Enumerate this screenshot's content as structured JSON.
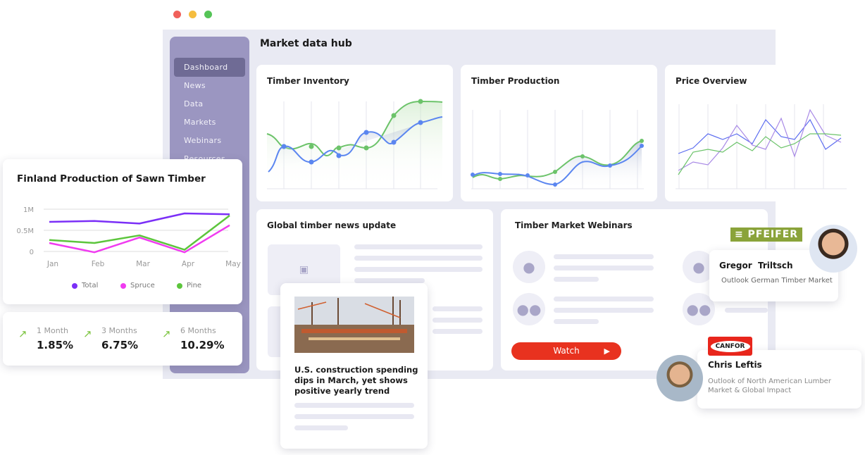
{
  "window": {
    "title": "Market data hub",
    "controls": [
      "close",
      "minimize",
      "maximize"
    ]
  },
  "sidebar": {
    "items": [
      {
        "label": "Dashboard",
        "active": true
      },
      {
        "label": "News"
      },
      {
        "label": "Data"
      },
      {
        "label": "Markets"
      },
      {
        "label": "Webinars"
      },
      {
        "label": "Resources"
      }
    ]
  },
  "cards": {
    "inventory": "Timber Inventory",
    "production": "Timber Production",
    "price": "Price Overview",
    "news": "Global timber news update",
    "webinars": "Timber Market Webinars",
    "watch": "Watch"
  },
  "finland": {
    "title": "Finland Production of Sawn Timber",
    "stats": [
      {
        "period": "1 Month",
        "value": "1.85%"
      },
      {
        "period": "3 Months",
        "value": "6.75%"
      },
      {
        "period": "6 Months",
        "value": "10.29%"
      }
    ]
  },
  "chart_data": {
    "type": "line",
    "title": "Finland Production of Sawn Timber",
    "categories": [
      "Jan",
      "Feb",
      "Mar",
      "Apr",
      "May"
    ],
    "ytick_labels": [
      "0",
      "0.5M",
      "1M"
    ],
    "ylim": [
      0,
      1000000
    ],
    "grid": true,
    "legend": "bottom",
    "series": [
      {
        "name": "Total",
        "color": "#7b2ff7",
        "values": [
          700000,
          720000,
          660000,
          900000,
          880000
        ]
      },
      {
        "name": "Spruce",
        "color": "#f03cf0",
        "values": [
          200000,
          -20000,
          330000,
          -20000,
          620000
        ]
      },
      {
        "name": "Pine",
        "color": "#5cc53c",
        "values": [
          270000,
          200000,
          380000,
          40000,
          850000
        ]
      }
    ]
  },
  "news_item": {
    "headline": "U.S. construction spending dips in March, yet shows positive yearly trend"
  },
  "speakers": [
    {
      "company": "PFEIFER",
      "name": "Gregor  Triltsch",
      "talk": "Outlook German Timber Market"
    },
    {
      "company": "CANFOR",
      "name": "Chris Leftis",
      "talk": "Outlook of North American Lumber Market & Global Impact"
    }
  ],
  "colors": {
    "sidebar": "#9b96c1",
    "accent_red": "#e8321f",
    "pfeifer": "#8aa33a",
    "canfor": "#e8261c"
  }
}
